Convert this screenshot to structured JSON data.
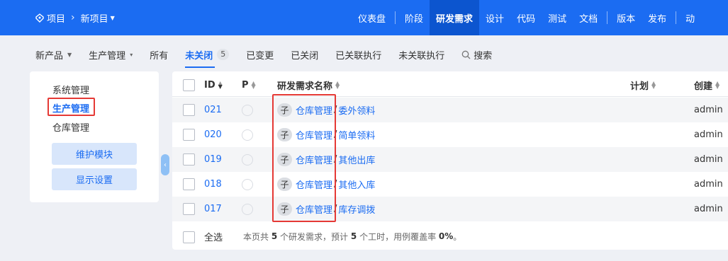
{
  "topbar": {
    "breadcrumb": {
      "root": "项目",
      "current": "新项目"
    },
    "nav": [
      "仪表盘",
      "阶段",
      "研发需求",
      "设计",
      "代码",
      "测试",
      "文档",
      "版本",
      "发布",
      "动"
    ],
    "active_nav": "研发需求",
    "accent": "#1b6cf2"
  },
  "subtabs": {
    "product": "新产品",
    "module": "生产管理",
    "items": [
      "所有",
      "未关闭",
      "已变更",
      "已关闭",
      "已关联执行",
      "未关联执行"
    ],
    "unclosed_count": "5",
    "search": "搜索"
  },
  "sidebar": {
    "modules": [
      "系统管理",
      "生产管理",
      "仓库管理"
    ],
    "active_module": "生产管理",
    "buttons": [
      "维护模块",
      "显示设置"
    ]
  },
  "table": {
    "columns": {
      "id": "ID",
      "priority": "P",
      "name": "研发需求名称",
      "plan": "计划",
      "creator": "创建"
    },
    "rows": [
      {
        "id": "021",
        "tag": "子",
        "parent": "仓库管理",
        "title": "委外领料",
        "creator": "admin"
      },
      {
        "id": "020",
        "tag": "子",
        "parent": "仓库管理",
        "title": "简单领料",
        "creator": "admin"
      },
      {
        "id": "019",
        "tag": "子",
        "parent": "仓库管理",
        "title": "其他出库",
        "creator": "admin"
      },
      {
        "id": "018",
        "tag": "子",
        "parent": "仓库管理",
        "title": "其他入库",
        "creator": "admin"
      },
      {
        "id": "017",
        "tag": "子",
        "parent": "仓库管理",
        "title": "库存调拨",
        "creator": "admin"
      }
    ],
    "select_all": "全选",
    "summary": {
      "prefix": "本页共",
      "story_count": "5",
      "middle": "个研发需求，预计",
      "hours": "5",
      "suffix_1": "个工时，用例覆盖率",
      "coverage": "0%",
      "suffix_2": "。"
    }
  },
  "colors": {
    "highlight": "#e53935",
    "topbar": "#1b6cf2",
    "active_nav_bg": "#0c55cf"
  }
}
